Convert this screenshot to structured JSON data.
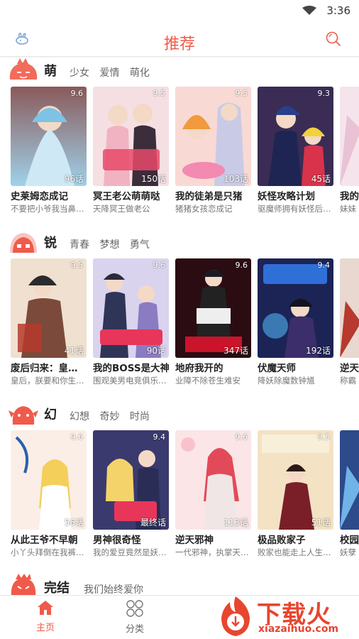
{
  "status": {
    "time": "3:36"
  },
  "header": {
    "title": "推荐"
  },
  "colors": {
    "accent": "#f05a4a"
  },
  "sections": [
    {
      "title": "萌",
      "tags": [
        "少女",
        "爱情",
        "萌化"
      ],
      "comics": [
        {
          "title": "史莱姆恋成记",
          "desc": "不要把小爷我当鼻…",
          "rating": "9.6",
          "chapters": "96话"
        },
        {
          "title": "冥王老公萌萌哒",
          "desc": "天降冥王做老公",
          "rating": "9.5",
          "chapters": "150话"
        },
        {
          "title": "我的徒弟是只猪",
          "desc": "猪猪女孩恋成记",
          "rating": "9.5",
          "chapters": "103话"
        },
        {
          "title": "妖怪攻略计划",
          "desc": "驱魔师拥有妖怪后…",
          "rating": "9.3",
          "chapters": "45话"
        },
        {
          "title": "我的",
          "desc": "妹妹",
          "rating": "",
          "chapters": ""
        }
      ]
    },
    {
      "title": "锐",
      "tags": [
        "青春",
        "梦想",
        "勇气"
      ],
      "comics": [
        {
          "title": "废后归来：皇…",
          "desc": "皇后，朕要和你生…",
          "rating": "9.5",
          "chapters": "41话"
        },
        {
          "title": "我的BOSS是大神",
          "desc": "围观美男电竞俱乐…",
          "rating": "9.6",
          "chapters": "90话"
        },
        {
          "title": "地府我开的",
          "desc": "业障不除苍生难安",
          "rating": "9.6",
          "chapters": "347话"
        },
        {
          "title": "伏魔天师",
          "desc": "降妖除魔数钟馗",
          "rating": "9.4",
          "chapters": "192话"
        },
        {
          "title": "逆天",
          "desc": "称霸",
          "rating": "",
          "chapters": ""
        }
      ]
    },
    {
      "title": "幻",
      "tags": [
        "幻想",
        "奇妙",
        "时尚"
      ],
      "comics": [
        {
          "title": "从此王爷不早朝",
          "desc": "小丫头拜倒在我裤…",
          "rating": "9.6",
          "chapters": "56话"
        },
        {
          "title": "男神很奇怪",
          "desc": "我的爱豆竟然是妖…",
          "rating": "9.4",
          "chapters": "最终话"
        },
        {
          "title": "逆天邪神",
          "desc": "一代邪神，执掌天…",
          "rating": "9.6",
          "chapters": "113话"
        },
        {
          "title": "极品败家子",
          "desc": "败家也能走上人生…",
          "rating": "9.5",
          "chapters": "51话"
        },
        {
          "title": "校园",
          "desc": "妖孽",
          "rating": "",
          "chapters": ""
        }
      ]
    },
    {
      "title": "完结",
      "tags": [
        "我们始终爱你"
      ],
      "comics": []
    }
  ],
  "nav": {
    "home": "主页",
    "category": "分类"
  },
  "watermark": {
    "text": "下载火",
    "sub": "xiazaihuo.com"
  }
}
